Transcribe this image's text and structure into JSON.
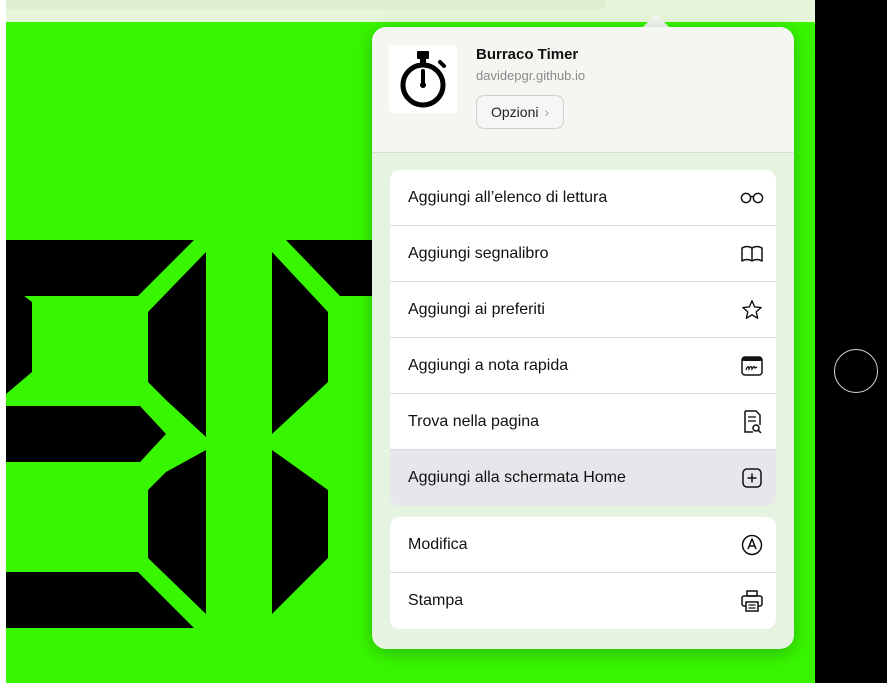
{
  "site": {
    "name": "Burraco Timer",
    "domain": "davidepgr.github.io",
    "options_label": "Opzioni"
  },
  "menu_group1": [
    {
      "label": "Aggiungi all’elenco di lettura",
      "icon": "glasses-icon"
    },
    {
      "label": "Aggiungi segnalibro",
      "icon": "book-icon"
    },
    {
      "label": "Aggiungi ai preferiti",
      "icon": "star-icon"
    },
    {
      "label": "Aggiungi a nota rapida",
      "icon": "quick-note-icon"
    },
    {
      "label": "Trova nella pagina",
      "icon": "find-in-page-icon"
    },
    {
      "label": "Aggiungi alla schermata Home",
      "icon": "add-square-icon",
      "highlighted": true
    }
  ],
  "menu_group2": [
    {
      "label": "Modifica",
      "icon": "markup-pen-icon"
    },
    {
      "label": "Stampa",
      "icon": "printer-icon"
    }
  ],
  "colors": {
    "page_background": "#38f600",
    "digit": "#000000",
    "highlight_row": "#e6e6eb"
  }
}
